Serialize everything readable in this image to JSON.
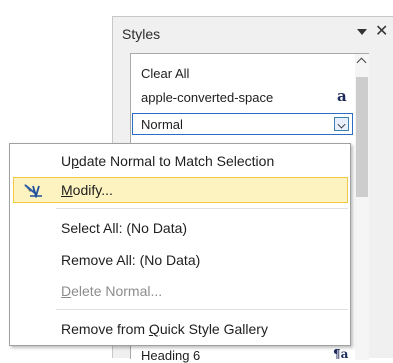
{
  "styles_pane": {
    "title": "Styles",
    "close_glyph": "✕",
    "items": [
      {
        "label": "Clear All"
      },
      {
        "label": "apple-converted-space",
        "type_glyph": "a"
      },
      {
        "label": "Normal",
        "selected": true
      }
    ],
    "bottom_item": {
      "label": "Heading 6",
      "type_glyph": "¶a"
    }
  },
  "context_menu": {
    "items": [
      {
        "pre": "U",
        "mnemonic": "p",
        "post": "date Normal to Match Selection",
        "enabled": true
      },
      {
        "pre": "",
        "mnemonic": "M",
        "post": "odify...",
        "enabled": true,
        "highlighted": true,
        "icon": "modify-style-icon"
      },
      {
        "pre": "Select All: (No Data)",
        "mnemonic": "",
        "post": "",
        "enabled": true
      },
      {
        "pre": "Remove All: (No Data)",
        "mnemonic": "",
        "post": "",
        "enabled": true
      },
      {
        "pre": "",
        "mnemonic": "D",
        "post": "elete Normal...",
        "enabled": false
      },
      {
        "pre": "Remove from ",
        "mnemonic": "Q",
        "post": "uick Style Gallery",
        "enabled": true
      }
    ]
  }
}
